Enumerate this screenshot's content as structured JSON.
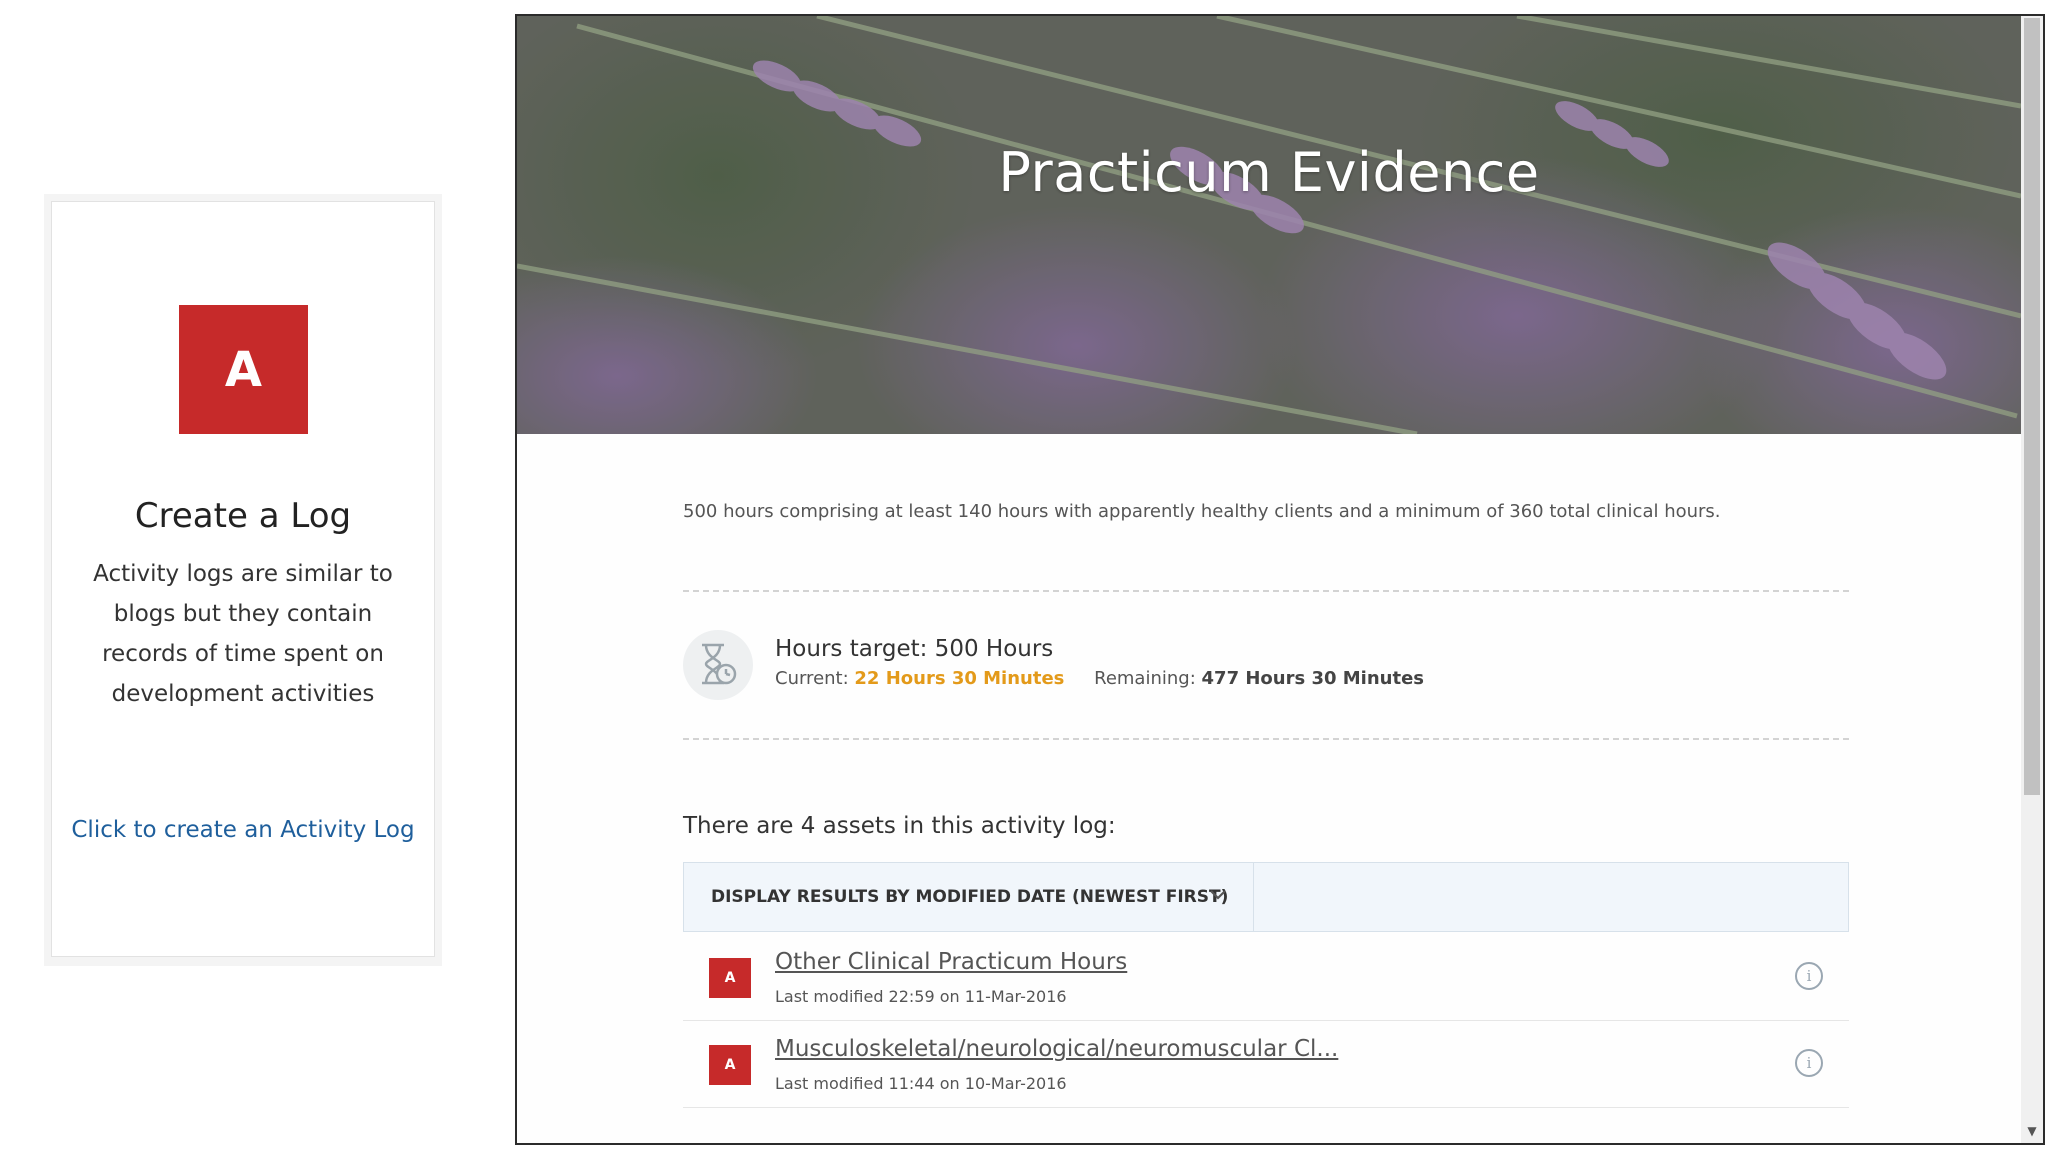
{
  "create_card": {
    "icon_letter": "A",
    "title": "Create a Log",
    "description": "Activity logs are similar to blogs but they contain records of time spent on development activities",
    "link": "Click to create an Activity Log"
  },
  "page": {
    "title": "Practicum Evidence",
    "description": "500 hours comprising at least 140 hours with apparently healthy clients and a minimum of 360 total clinical hours."
  },
  "hours": {
    "target_text": "Hours target: 500 Hours",
    "current_label": "Current:",
    "current_value": "22 Hours 30 Minutes",
    "remaining_label": "Remaining:",
    "remaining_value": "477 Hours 30 Minutes"
  },
  "assets": {
    "count_text": "There are 4 assets in this activity log:",
    "sort_label": "DISPLAY RESULTS BY MODIFIED DATE (NEWEST FIRST)",
    "items": [
      {
        "icon_letter": "A",
        "title": "Other Clinical Practicum Hours",
        "modified": "Last modified 22:59 on 11-Mar-2016"
      },
      {
        "icon_letter": "A",
        "title": "Musculoskeletal/neurological/neuromuscular Cl...",
        "modified": "Last modified 11:44 on 10-Mar-2016"
      }
    ]
  },
  "colors": {
    "asset_red": "#c62a2a",
    "link_blue": "#1f5f9c",
    "current_orange": "#e39a1a",
    "sort_bar_bg": "#f1f6fb"
  },
  "icons": {
    "hours": "hourglass-clock-icon",
    "sort": "chevron-down-icon",
    "info": "info-icon"
  }
}
